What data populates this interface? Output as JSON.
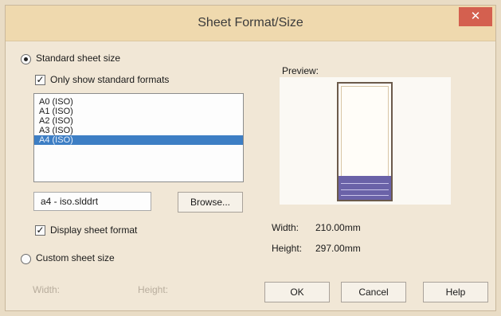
{
  "dialog": {
    "title": "Sheet Format/Size",
    "close_glyph": "✕"
  },
  "standard": {
    "radio_label": "Standard sheet size",
    "only_standard_label": "Only show standard formats",
    "formats": [
      "A0 (ISO)",
      "A1 (ISO)",
      "A2 (ISO)",
      "A3 (ISO)",
      "A4 (ISO)"
    ],
    "selected_index": 4,
    "template_file": "a4 - iso.slddrt",
    "browse_label": "Browse...",
    "display_format_label": "Display sheet format"
  },
  "custom": {
    "radio_label": "Custom sheet size",
    "width_label": "Width:",
    "height_label": "Height:"
  },
  "preview": {
    "label": "Preview:",
    "width_label": "Width:",
    "width_value": "210.00mm",
    "height_label": "Height:",
    "height_value": "297.00mm"
  },
  "buttons": {
    "ok": "OK",
    "cancel": "Cancel",
    "help": "Help"
  },
  "colors": {
    "selection": "#3d7ec4",
    "close": "#d4604f",
    "title_block": "#6a62a8"
  }
}
